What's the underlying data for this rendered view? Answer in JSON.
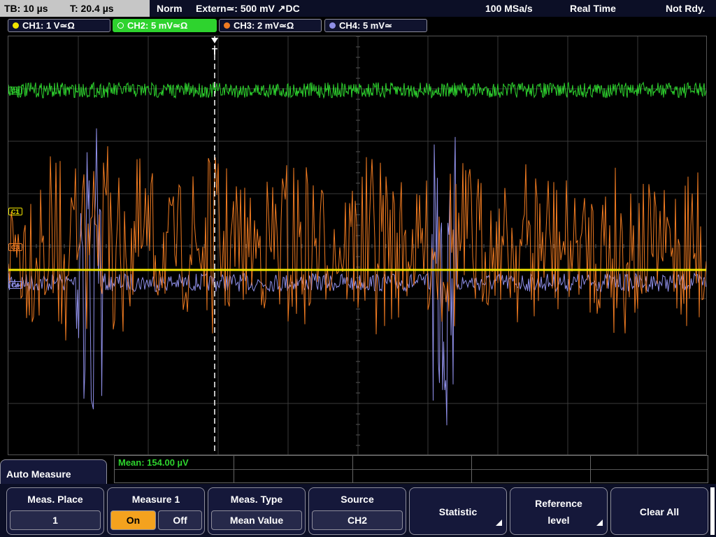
{
  "status_bar": {
    "timebase": "TB: 10 µs",
    "trigger_time": "T: 20.4 µs",
    "mode": "Norm",
    "trigger_source": "Extern≃: 500 mV ↗DC",
    "sample_rate": "100 MSa/s",
    "acquisition": "Real Time",
    "state": "Not Rdy."
  },
  "channels": [
    {
      "label": "CH1: 1 V≃Ω",
      "color": "#f2e600"
    },
    {
      "label": "CH2: 5 mV≃Ω",
      "color": "#2ed32e"
    },
    {
      "label": "CH3: 2 mV≃Ω",
      "color": "#f07b21"
    },
    {
      "label": "CH4: 5 mV≃",
      "color": "#8f8fe8"
    }
  ],
  "channel_markers": {
    "c1": "C1",
    "c2": "C2",
    "c3": "C3",
    "c4": "C4"
  },
  "trigger_marker": "T",
  "measurement": {
    "text": "Mean: 154.00 µV"
  },
  "menu": {
    "title": "Auto Measure",
    "softkeys": {
      "meas_place": {
        "label": "Meas. Place",
        "value": "1"
      },
      "measure_1": {
        "label": "Measure 1",
        "on": "On",
        "off": "Off"
      },
      "meas_type": {
        "label": "Meas. Type",
        "value": "Mean Value"
      },
      "source": {
        "label": "Source",
        "value": "CH2"
      },
      "statistic": {
        "label": "Statistic"
      },
      "reference_level": {
        "label_line1": "Reference",
        "label_line2": "level"
      },
      "clear_all": {
        "label": "Clear All"
      }
    }
  },
  "colors": {
    "grid": "#3a3a3a",
    "ch1": "#f2e600",
    "ch2": "#2ed32e",
    "ch3": "#f07b21",
    "ch4": "#8f8fe8",
    "accent_on": "#f4a21e"
  }
}
